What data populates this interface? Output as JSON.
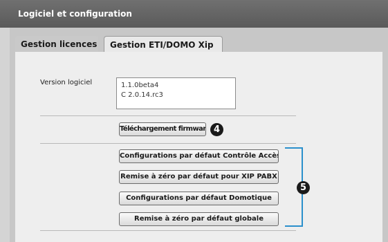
{
  "window": {
    "title": "Logiciel et configuration"
  },
  "tabs": [
    {
      "label": "Gestion licences"
    },
    {
      "label": "Gestion ETI/DOMO Xip"
    }
  ],
  "version": {
    "label": "Version logiciel",
    "lines": [
      "1.1.0beta4",
      "C 2.0.14.rc3"
    ]
  },
  "buttons": {
    "firmware": "Téléchargement firmware",
    "config_access": "Configurations par défaut Contrôle Accès",
    "reset_xip": "Remise à zéro par défaut pour XIP PABX",
    "config_domotique": "Configurations par défaut Domotique",
    "reset_global": "Remise à zéro par défaut globale"
  },
  "callouts": {
    "firmware": "4",
    "defaults_group": "5"
  },
  "colors": {
    "bracket": "#2a8fcc",
    "title_text": "#ffffff"
  }
}
